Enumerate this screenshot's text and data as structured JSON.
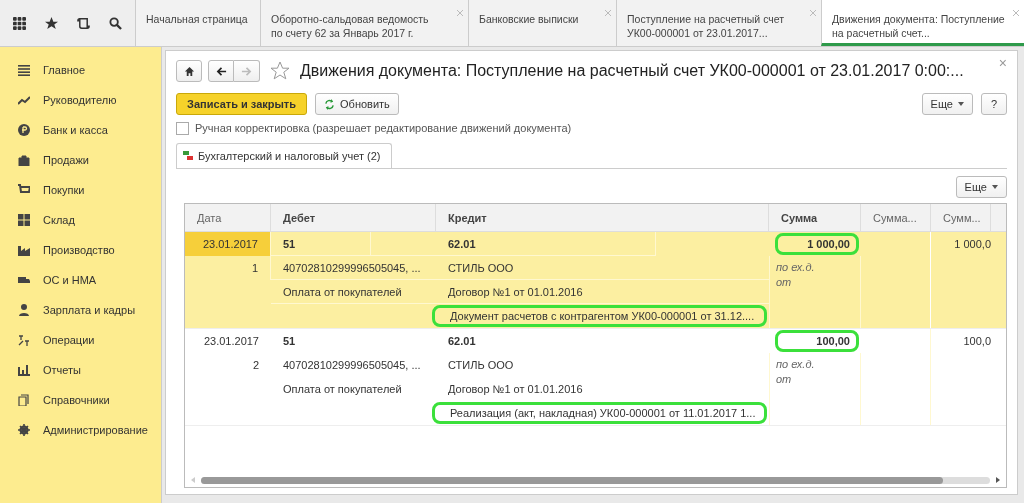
{
  "toolbar": {
    "tabs": [
      {
        "label": "Начальная страница",
        "selected": false,
        "closable": false
      },
      {
        "label": "Оборотно-сальдовая ведомость по счету 62 за Январь 2017 г.",
        "selected": false,
        "closable": true
      },
      {
        "label": "Банковские выписки",
        "selected": false,
        "closable": true
      },
      {
        "label": "Поступление на расчетный счет УК00-000001 от 23.01.2017...",
        "selected": false,
        "closable": true
      },
      {
        "label": "Движения документа: Поступление на расчетный счет...",
        "selected": true,
        "closable": true
      }
    ]
  },
  "sidebar": {
    "items": [
      {
        "label": "Главное"
      },
      {
        "label": "Руководителю"
      },
      {
        "label": "Банк и касса"
      },
      {
        "label": "Продажи"
      },
      {
        "label": "Покупки"
      },
      {
        "label": "Склад"
      },
      {
        "label": "Производство"
      },
      {
        "label": "ОС и НМА"
      },
      {
        "label": "Зарплата и кадры"
      },
      {
        "label": "Операции"
      },
      {
        "label": "Отчеты"
      },
      {
        "label": "Справочники"
      },
      {
        "label": "Администрирование"
      }
    ]
  },
  "form": {
    "title": "Движения документа: Поступление на расчетный счет УК00-000001 от 23.01.2017 0:00:...",
    "close": "×",
    "save_button": "Записать и закрыть",
    "refresh_button": "Обновить",
    "more_button": "Еще",
    "help_button": "?",
    "manual_checkbox": {
      "label": "Ручная корректировка (разрешает редактирование движений документа)",
      "checked": false
    },
    "tabs": [
      {
        "label": "Бухгалтерский и налоговый учет (2)",
        "selected": true
      }
    ],
    "table_more_button": "Еще",
    "table": {
      "columns": [
        "Дата",
        "Дебет",
        "Кредит",
        "Сумма",
        "Сумма...",
        "Сумм..."
      ],
      "rows": [
        {
          "selected": true,
          "date": "23.01.2017",
          "number": "1",
          "debit_account": "51",
          "debit_subconto_1": "40702810299996505045, ...",
          "debit_subconto_2": "Оплата от покупателей",
          "credit_account": "62.01",
          "credit_subconto_1": "СТИЛЬ ООО",
          "credit_subconto_2": "Договор №1 от 01.01.2016",
          "credit_subconto_3": "Документ расчетов с контрагентом УК00-000001 от 31.12....",
          "credit_circled": true,
          "sum": "1 000,00",
          "sum_circled": true,
          "sum_note": "по ех.д. от",
          "column_6": "1 000,0"
        },
        {
          "selected": false,
          "date": "23.01.2017",
          "number": "2",
          "debit_account": "51",
          "debit_subconto_1": "40702810299996505045, ...",
          "debit_subconto_2": "Оплата от покупателей",
          "credit_account": "62.01",
          "credit_subconto_1": "СТИЛЬ ООО",
          "credit_subconto_2": "Договор №1 от 01.01.2016",
          "credit_subconto_3": "Реализация (акт, накладная) УК00-000001 от 11.01.2017 1...",
          "credit_circled": true,
          "sum": "100,00",
          "sum_circled": true,
          "sum_note": "по ех.д. от",
          "column_6": "100,0"
        }
      ]
    }
  }
}
